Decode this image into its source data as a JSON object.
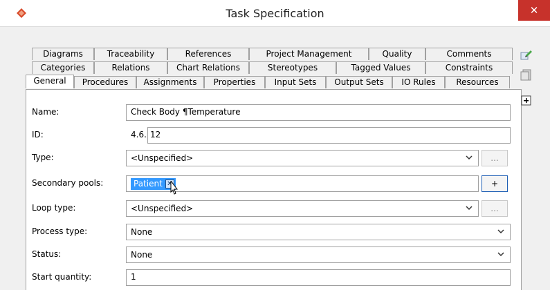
{
  "window": {
    "title": "Task Specification",
    "close_label": "✕"
  },
  "tabs": {
    "row1": [
      "Diagrams",
      "Traceability",
      "References",
      "Project Management",
      "Quality",
      "Comments"
    ],
    "row2": [
      "Categories",
      "Relations",
      "Chart Relations",
      "Stereotypes",
      "Tagged Values",
      "Constraints"
    ],
    "row3": [
      "General",
      "Procedures",
      "Assignments",
      "Properties",
      "Input Sets",
      "Output Sets",
      "IO Rules",
      "Resources"
    ],
    "active": "General"
  },
  "form": {
    "name": {
      "label": "Name:",
      "value": "Check Body ¶Temperature"
    },
    "id": {
      "label": "ID:",
      "prefix": "4.6.",
      "value": "12"
    },
    "type": {
      "label": "Type:",
      "value": "<Unspecified>",
      "button": "..."
    },
    "secondary_pools": {
      "label": "Secondary pools:",
      "chip": "Patient",
      "chip_x": "✕",
      "button": "+"
    },
    "loop_type": {
      "label": "Loop type:",
      "value": "<Unspecified>",
      "button": "..."
    },
    "process_type": {
      "label": "Process type:",
      "value": "None"
    },
    "status": {
      "label": "Status:",
      "value": "None"
    },
    "start_quantity": {
      "label": "Start quantity:",
      "value": "1"
    }
  },
  "side_icons": [
    "edit-icon",
    "doc-icon",
    "add-icon"
  ],
  "colors": {
    "close": "#c7322b",
    "chip": "#3399ff",
    "focus_border": "#1f5fb5"
  }
}
